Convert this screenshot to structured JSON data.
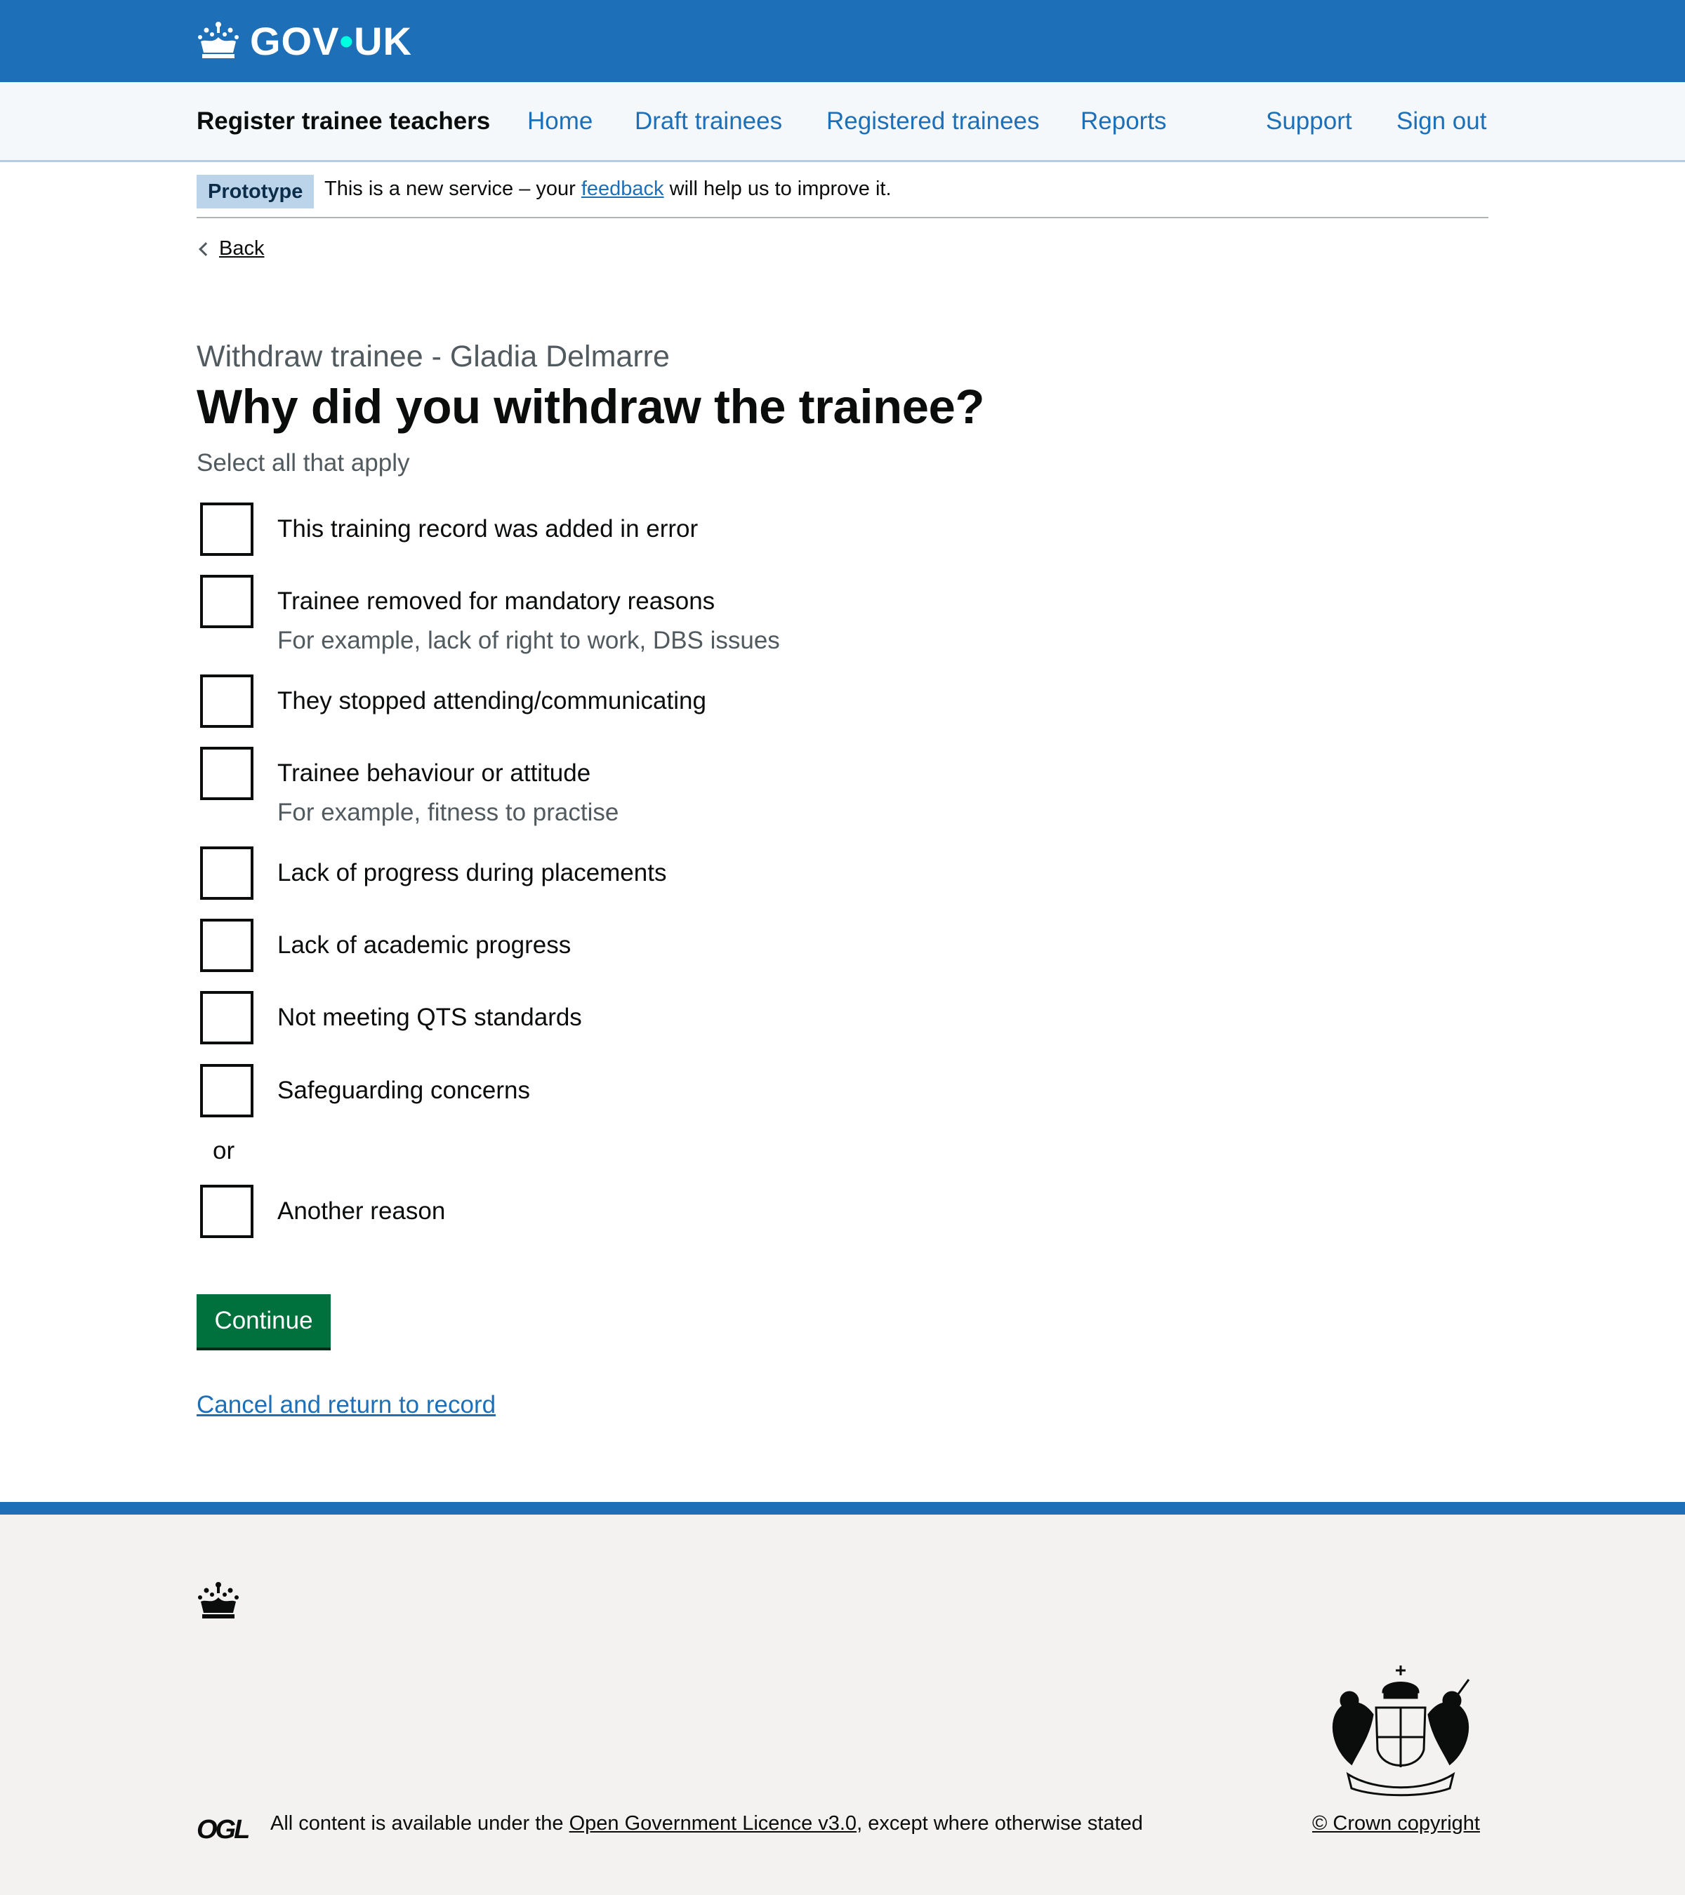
{
  "header": {
    "logo_text": "GOV",
    "logo_dot": "•",
    "logo_text_2": "UK"
  },
  "service_nav": {
    "service_name": "Register trainee teachers",
    "links": [
      {
        "label": "Home"
      },
      {
        "label": "Draft trainees"
      },
      {
        "label": "Registered trainees"
      },
      {
        "label": "Reports"
      },
      {
        "label": "Support"
      },
      {
        "label": "Sign out"
      }
    ]
  },
  "phase_banner": {
    "tag": "Prototype",
    "text_before": "This is a new service – your ",
    "link": "feedback",
    "text_after": " will help us to improve it."
  },
  "back_link": "Back",
  "main": {
    "caption": "Withdraw trainee - Gladia Delmarre",
    "heading": "Why did you withdraw the trainee?",
    "hint": "Select all that apply",
    "options": [
      {
        "label": "This training record was added in error",
        "hint": ""
      },
      {
        "label": "Trainee removed for mandatory reasons",
        "hint": "For example, lack of right to work, DBS issues"
      },
      {
        "label": "They stopped attending/communicating",
        "hint": ""
      },
      {
        "label": "Trainee behaviour or attitude",
        "hint": "For example, fitness to practise"
      },
      {
        "label": "Lack of progress during placements",
        "hint": ""
      },
      {
        "label": "Lack of academic progress",
        "hint": ""
      },
      {
        "label": "Not meeting QTS standards",
        "hint": ""
      },
      {
        "label": "Safeguarding concerns",
        "hint": ""
      }
    ],
    "divider": "or",
    "other_option": {
      "label": "Another reason"
    },
    "continue_label": "Continue",
    "cancel_label": "Cancel and return to record"
  },
  "footer": {
    "ogl": "OGL",
    "licence_before": "All content is available under the ",
    "licence_link": "Open Government Licence v3.0",
    "licence_after": ", except where otherwise stated",
    "copyright": "© Crown copyright"
  },
  "colors": {
    "header_blue": "#1d70b8",
    "button_green": "#00703c",
    "nav_background": "#f4f8fb",
    "footer_background": "#f3f2f1"
  }
}
